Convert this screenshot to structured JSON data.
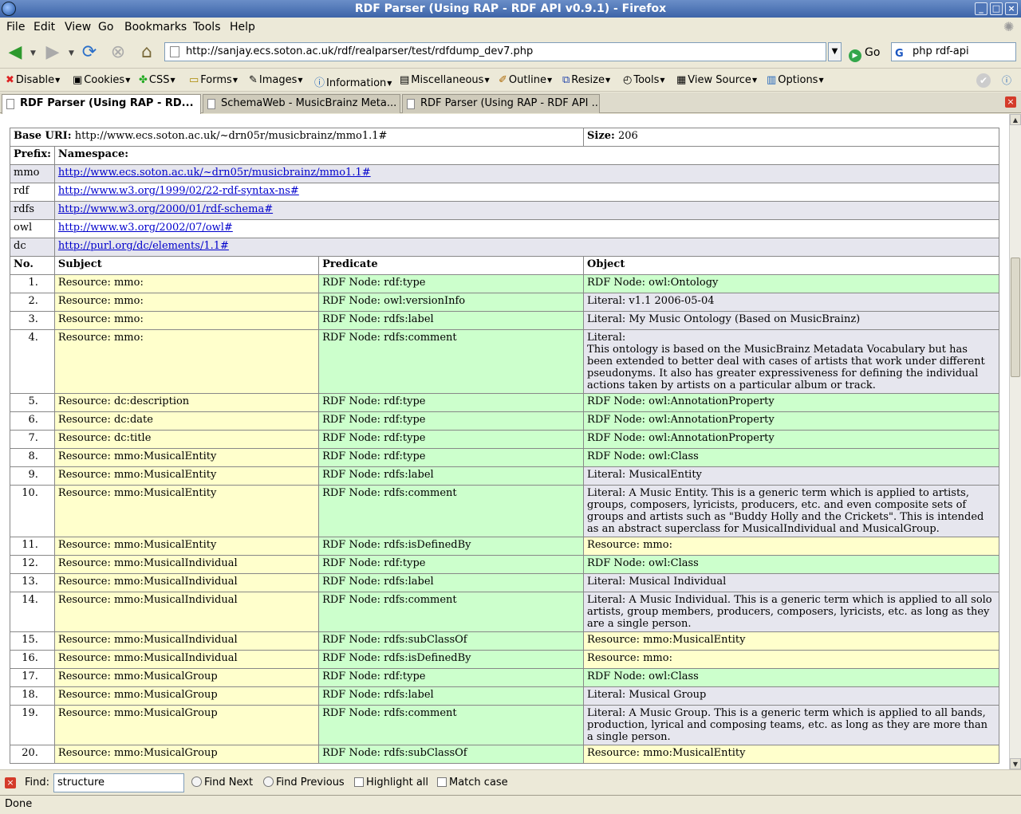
{
  "window": {
    "title": "RDF Parser (Using RAP - RDF API v0.9.1) - Firefox"
  },
  "menu": [
    "File",
    "Edit",
    "View",
    "Go",
    "Bookmarks",
    "Tools",
    "Help"
  ],
  "nav": {
    "url": "http://sanjay.ecs.soton.ac.uk/rdf/realparser/test/rdfdump_dev7.php",
    "go_label": "Go",
    "search_value": "php rdf-api"
  },
  "devtoolbar": [
    "Disable",
    "Cookies",
    "CSS",
    "Forms",
    "Images",
    "Information",
    "Miscellaneous",
    "Outline",
    "Resize",
    "Tools",
    "View Source",
    "Options"
  ],
  "tabs": [
    "RDF Parser (Using RAP - RD...",
    "SchemaWeb - MusicBrainz Meta...",
    "RDF Parser (Using RAP - RDF API ..."
  ],
  "rdf": {
    "base_label": "Base URI:",
    "base_uri": "http://www.ecs.soton.ac.uk/~drn05r/musicbrainz/mmo1.1#",
    "size_label": "Size:",
    "size": "206",
    "prefix_header": "Prefix:",
    "namespace_header": "Namespace:",
    "namespaces": [
      {
        "prefix": "mmo",
        "uri": "http://www.ecs.soton.ac.uk/~drn05r/musicbrainz/mmo1.1#"
      },
      {
        "prefix": "rdf",
        "uri": "http://www.w3.org/1999/02/22-rdf-syntax-ns#"
      },
      {
        "prefix": "rdfs",
        "uri": "http://www.w3.org/2000/01/rdf-schema#"
      },
      {
        "prefix": "owl",
        "uri": "http://www.w3.org/2002/07/owl#"
      },
      {
        "prefix": "dc",
        "uri": "http://purl.org/dc/elements/1.1#"
      }
    ],
    "columns": [
      "No.",
      "Subject",
      "Predicate",
      "Object"
    ],
    "triples": [
      {
        "no": "1.",
        "s": "Resource: mmo:",
        "p": "RDF Node: rdf:type",
        "o": "RDF Node: owl:Ontology",
        "ok": "node"
      },
      {
        "no": "2.",
        "s": "Resource: mmo:",
        "p": "RDF Node: owl:versionInfo",
        "o": "Literal: v1.1 2006-05-04",
        "ok": "lit"
      },
      {
        "no": "3.",
        "s": "Resource: mmo:",
        "p": "RDF Node: rdfs:label",
        "o": "Literal: My Music Ontology (Based on MusicBrainz)",
        "ok": "lit"
      },
      {
        "no": "4.",
        "s": "Resource: mmo:",
        "p": "RDF Node: rdfs:comment",
        "o": "Literal:\nThis ontology is based on the MusicBrainz Metadata Vocabulary but has been extended to better deal with cases of artists that work under different pseudonyms. It also has greater expressiveness for defining the individual actions taken by artists on a particular album or track.",
        "ok": "lit"
      },
      {
        "no": "5.",
        "s": "Resource: dc:description",
        "p": "RDF Node: rdf:type",
        "o": "RDF Node: owl:AnnotationProperty",
        "ok": "node"
      },
      {
        "no": "6.",
        "s": "Resource: dc:date",
        "p": "RDF Node: rdf:type",
        "o": "RDF Node: owl:AnnotationProperty",
        "ok": "node"
      },
      {
        "no": "7.",
        "s": "Resource: dc:title",
        "p": "RDF Node: rdf:type",
        "o": "RDF Node: owl:AnnotationProperty",
        "ok": "node"
      },
      {
        "no": "8.",
        "s": "Resource: mmo:MusicalEntity",
        "p": "RDF Node: rdf:type",
        "o": "RDF Node: owl:Class",
        "ok": "node"
      },
      {
        "no": "9.",
        "s": "Resource: mmo:MusicalEntity",
        "p": "RDF Node: rdfs:label",
        "o": "Literal: MusicalEntity",
        "ok": "lit"
      },
      {
        "no": "10.",
        "s": "Resource: mmo:MusicalEntity",
        "p": "RDF Node: rdfs:comment",
        "o": "Literal: A Music Entity. This is a generic term which is applied to artists, groups, composers, lyricists, producers, etc. and even composite sets of groups and artists such as \"Buddy Holly and the Crickets\". This is intended as an abstract superclass for MusicalIndividual and MusicalGroup.",
        "ok": "lit"
      },
      {
        "no": "11.",
        "s": "Resource: mmo:MusicalEntity",
        "p": "RDF Node: rdfs:isDefinedBy",
        "o": "Resource: mmo:",
        "ok": "res"
      },
      {
        "no": "12.",
        "s": "Resource: mmo:MusicalIndividual",
        "p": "RDF Node: rdf:type",
        "o": "RDF Node: owl:Class",
        "ok": "node"
      },
      {
        "no": "13.",
        "s": "Resource: mmo:MusicalIndividual",
        "p": "RDF Node: rdfs:label",
        "o": "Literal: Musical Individual",
        "ok": "lit"
      },
      {
        "no": "14.",
        "s": "Resource: mmo:MusicalIndividual",
        "p": "RDF Node: rdfs:comment",
        "o": "Literal: A Music Individual. This is a generic term which is applied to all solo artists, group members, producers, composers, lyricists, etc. as long as they are a single person.",
        "ok": "lit"
      },
      {
        "no": "15.",
        "s": "Resource: mmo:MusicalIndividual",
        "p": "RDF Node: rdfs:subClassOf",
        "o": "Resource: mmo:MusicalEntity",
        "ok": "res"
      },
      {
        "no": "16.",
        "s": "Resource: mmo:MusicalIndividual",
        "p": "RDF Node: rdfs:isDefinedBy",
        "o": "Resource: mmo:",
        "ok": "res"
      },
      {
        "no": "17.",
        "s": "Resource: mmo:MusicalGroup",
        "p": "RDF Node: rdf:type",
        "o": "RDF Node: owl:Class",
        "ok": "node"
      },
      {
        "no": "18.",
        "s": "Resource: mmo:MusicalGroup",
        "p": "RDF Node: rdfs:label",
        "o": "Literal: Musical Group",
        "ok": "lit"
      },
      {
        "no": "19.",
        "s": "Resource: mmo:MusicalGroup",
        "p": "RDF Node: rdfs:comment",
        "o": "Literal: A Music Group. This is a generic term which is applied to all bands, production, lyrical and composing teams, etc. as long as they are more than a single person.",
        "ok": "lit"
      },
      {
        "no": "20.",
        "s": "Resource: mmo:MusicalGroup",
        "p": "RDF Node: rdfs:subClassOf",
        "o": "Resource: mmo:MusicalEntity",
        "ok": "res"
      }
    ]
  },
  "findbar": {
    "label": "Find:",
    "value": "structure",
    "find_next": "Find Next",
    "find_previous": "Find Previous",
    "highlight_all": "Highlight all",
    "match_case": "Match case"
  },
  "status": "Done"
}
